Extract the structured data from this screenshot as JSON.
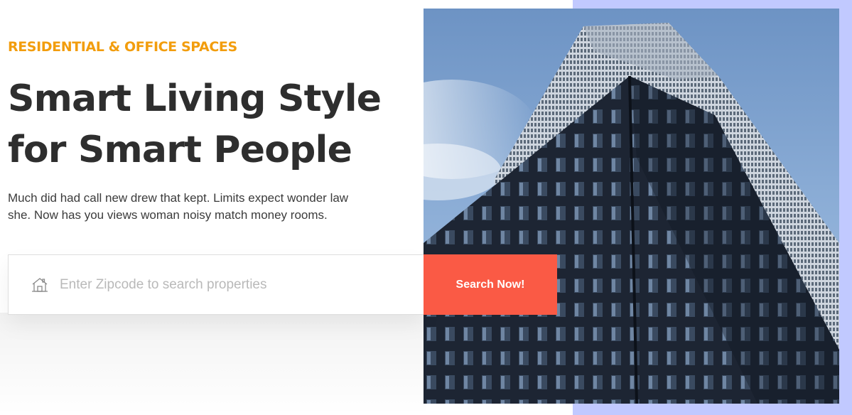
{
  "hero": {
    "eyebrow": "RESIDENTIAL & OFFICE SPACES",
    "headline_line1": "Smart Living Style",
    "headline_line2": "for Smart People",
    "description_line1": "Much did had call new drew that kept. Limits expect wonder law",
    "description_line2": "she. Now has you views woman noisy match money rooms.",
    "image_alt": "Skyscraper photo"
  },
  "search": {
    "placeholder": "Enter Zipcode to search properties",
    "value": "",
    "button_label": "Search Now!",
    "icon": "home-icon"
  },
  "colors": {
    "eyebrow": "#f29d0d",
    "headline": "#2e2e2e",
    "button": "#fa5a45",
    "accent_block": "#c1c9ff"
  }
}
